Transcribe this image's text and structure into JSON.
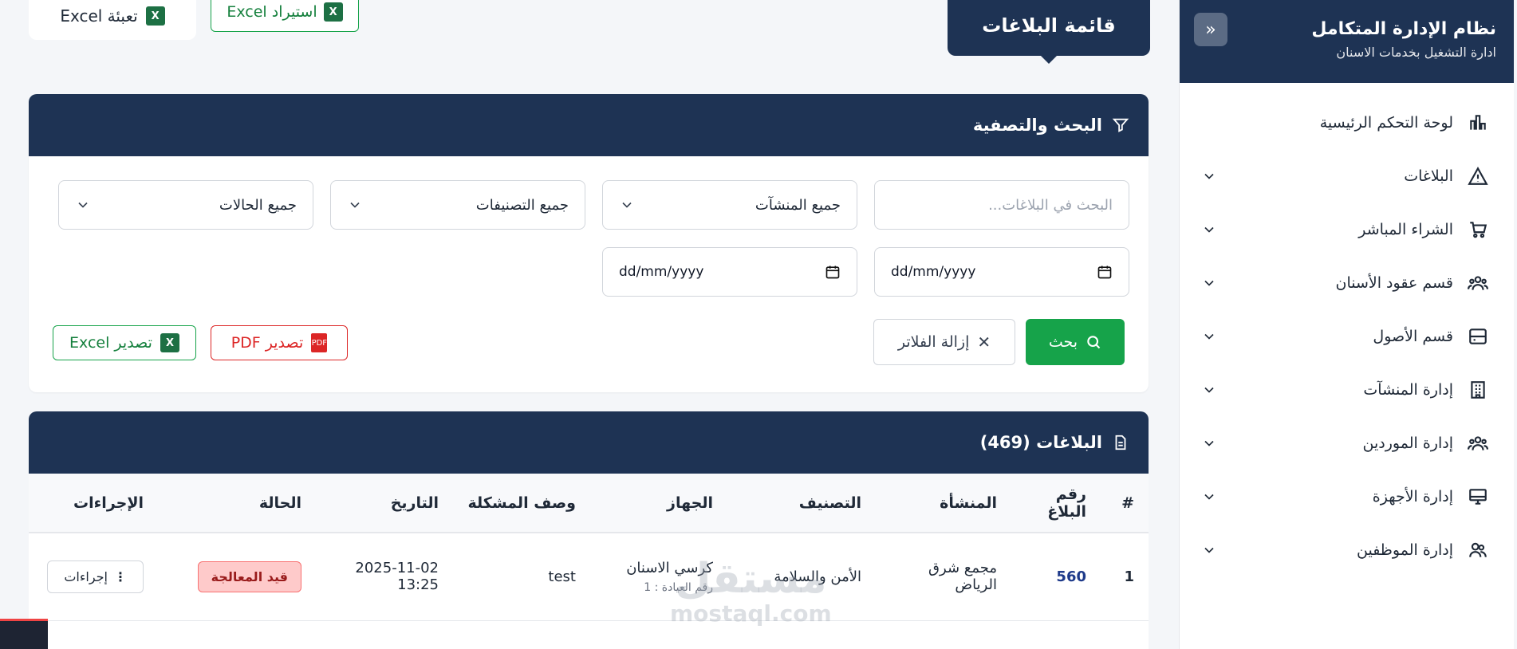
{
  "sidebar": {
    "title": "نظام الإدارة المتكامل",
    "subtitle": "ادارة التشغيل بخدمات الاسنان",
    "items": [
      {
        "label": "لوحة التحكم الرئيسية",
        "icon": "chart-icon",
        "has_chevron": false
      },
      {
        "label": "البلاغات",
        "icon": "warning-icon",
        "has_chevron": true
      },
      {
        "label": "الشراء المباشر",
        "icon": "cart-icon",
        "has_chevron": true
      },
      {
        "label": "قسم عقود الأسنان",
        "icon": "users-icon",
        "has_chevron": true
      },
      {
        "label": "قسم الأصول",
        "icon": "server-icon",
        "has_chevron": true
      },
      {
        "label": "إدارة المنشآت",
        "icon": "building-icon",
        "has_chevron": true
      },
      {
        "label": "إدارة الموردين",
        "icon": "users-icon",
        "has_chevron": true
      },
      {
        "label": "إدارة الأجهزة",
        "icon": "monitor-icon",
        "has_chevron": true
      },
      {
        "label": "إدارة الموظفين",
        "icon": "user-group-icon",
        "has_chevron": true
      }
    ]
  },
  "top": {
    "fill_excel_label": "تعبئة Excel",
    "import_excel_label": "استيراد Excel",
    "page_title": "قائمة البلاغات"
  },
  "filters": {
    "heading": "البحث والتصفية",
    "search_placeholder": "البحث في البلاغات...",
    "facility_select": "جميع المنشآت",
    "category_select": "جميع التصنيفات",
    "status_select": "جميع الحالات",
    "date_from": "dd/mm/yyyy",
    "date_to": "dd/mm/yyyy",
    "search_button": "بحث",
    "clear_button": "إزالة الفلاتر",
    "export_pdf": "تصدير PDF",
    "export_excel": "تصدير Excel"
  },
  "table": {
    "heading": "البلاغات (469)",
    "columns": [
      "#",
      "رقم البلاغ",
      "المنشأة",
      "التصنيف",
      "الجهاز",
      "وصف المشكلة",
      "التاريخ",
      "الحالة",
      "الإجراءات"
    ],
    "rows": [
      {
        "index": "1",
        "number": "560",
        "facility": "مجمع شرق الرياض",
        "category": "الأمن والسلامة",
        "device": "كرسي الاسنان",
        "device_note": "رقم العيادة : 1",
        "description": "test",
        "date": "2025-11-02 13:25",
        "status": "قيد المعالجة",
        "actions": "إجراءات"
      }
    ]
  },
  "watermark": {
    "line1": "مستقل",
    "line2": "mostaql.com"
  },
  "colors": {
    "navy": "#1e3354",
    "green": "#16a34a",
    "red": "#dc2626"
  }
}
